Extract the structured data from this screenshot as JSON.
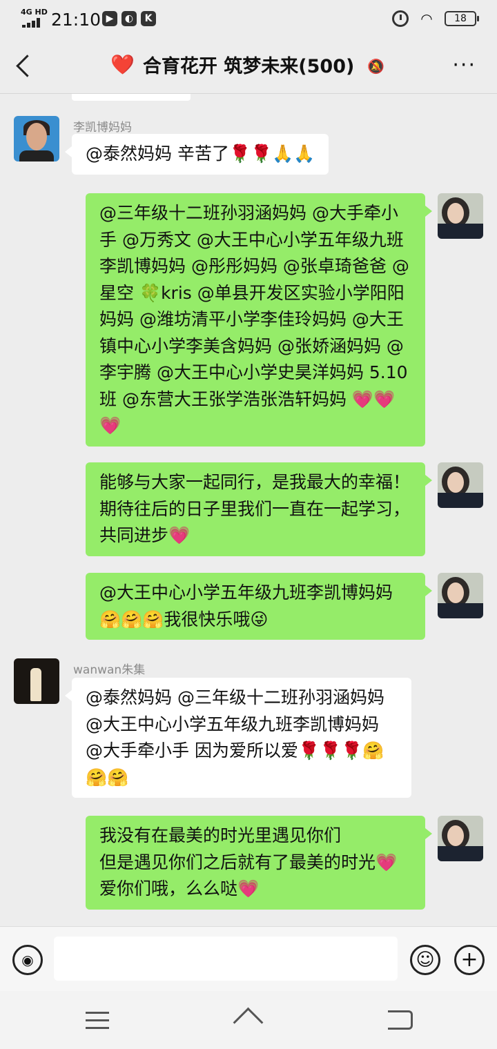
{
  "status_bar": {
    "network": "4G HD",
    "time": "21:10",
    "app_icons": [
      "▶",
      "◐",
      "K"
    ],
    "battery": "18"
  },
  "header": {
    "heart": "❤️",
    "title": "合育花开 筑梦未来(500)",
    "mute_icon": "bell-muted",
    "more_label": "···"
  },
  "messages": [
    {
      "side": "left",
      "sender": "李凯博妈妈",
      "text": "@泰然妈妈  辛苦了🌹🌹🙏🙏"
    },
    {
      "side": "right",
      "text": "@三年级十二班孙羽涵妈妈 @大手牵小手 @万秀文 @大王中心小学五年级九班李凯博妈妈 @彤彤妈妈 @张卓琦爸爸 @星空 🍀kris @单县开发区实验小学阳阳妈妈 @潍坊清平小学李佳玲妈妈 @大王镇中心小学李美含妈妈 @张娇涵妈妈 @李宇腾 @大王中心小学史昊洋妈妈 5.10 班 @东营大王张学浩张浩轩妈妈 💗💗💗"
    },
    {
      "side": "right",
      "text": "能够与大家一起同行，是我最大的幸福！期待往后的日子里我们一直在一起学习，共同进步💗"
    },
    {
      "side": "right",
      "text": "@大王中心小学五年级九班李凯博妈妈 🤗🤗🤗我很快乐哦😜"
    },
    {
      "side": "left",
      "sender": "wanwan朱集",
      "text": "@泰然妈妈 @三年级十二班孙羽涵妈妈 @大王中心小学五年级九班李凯博妈妈 @大手牵小手  因为爱所以爱🌹🌹🌹🤗🤗🤗"
    },
    {
      "side": "right",
      "text": "我没有在最美的时光里遇见你们\n但是遇见你们之后就有了最美的时光💗爱你们哦，么么哒💗"
    }
  ],
  "input": {
    "value": "",
    "voice_icon": "voice",
    "emoji_icon": "😀",
    "plus_icon": "+"
  }
}
